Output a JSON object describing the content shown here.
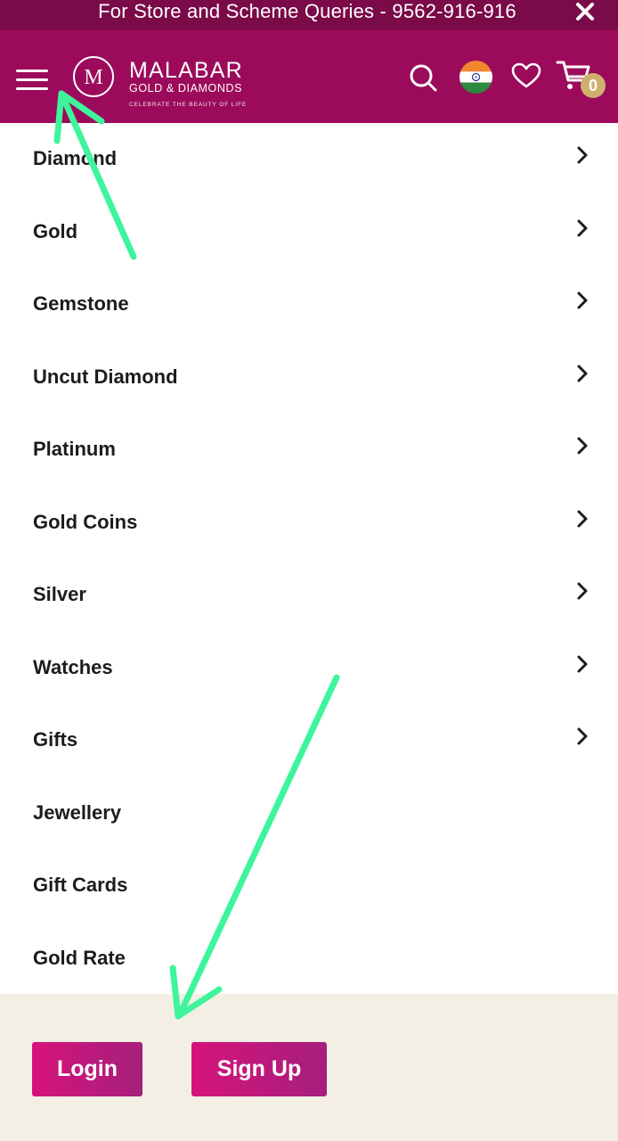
{
  "top_bar": {
    "message": "For Store and Scheme Queries - 9562-916-916",
    "close_icon": "close-icon"
  },
  "header": {
    "brand_name": "MALABAR",
    "brand_sub": "GOLD & DIAMONDS",
    "brand_tagline": "CELEBRATE THE BEAUTY OF LIFE",
    "logo_letter": "M",
    "icons": [
      "menu-icon",
      "search-icon",
      "india-flag-icon",
      "heart-icon",
      "cart-icon"
    ],
    "cart_count": "0",
    "brand_color": "#9c0b5b"
  },
  "menu": {
    "items": [
      {
        "label": "Diamond",
        "has_submenu": true
      },
      {
        "label": "Gold",
        "has_submenu": true
      },
      {
        "label": "Gemstone",
        "has_submenu": true
      },
      {
        "label": "Uncut Diamond",
        "has_submenu": true
      },
      {
        "label": "Platinum",
        "has_submenu": true
      },
      {
        "label": "Gold Coins",
        "has_submenu": true
      },
      {
        "label": "Silver",
        "has_submenu": true
      },
      {
        "label": "Watches",
        "has_submenu": true
      },
      {
        "label": "Gifts",
        "has_submenu": true
      },
      {
        "label": "Jewellery",
        "has_submenu": false
      },
      {
        "label": "Gift Cards",
        "has_submenu": false
      },
      {
        "label": "Gold Rate",
        "has_submenu": false
      }
    ]
  },
  "auth": {
    "login_label": "Login",
    "signup_label": "Sign Up",
    "button_color": "#d6137a"
  },
  "annotation_color": "#3ef59b"
}
